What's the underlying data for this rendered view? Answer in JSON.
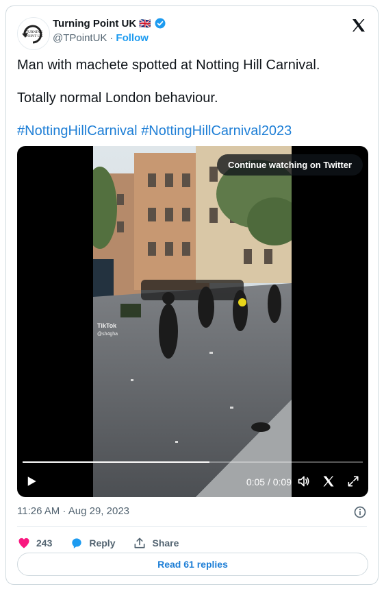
{
  "author": {
    "display_name": "Turning Point UK",
    "flag": "🇬🇧",
    "handle": "@TPointUK",
    "separator": "·",
    "follow_label": "Follow",
    "avatar_text_top": "TURNING",
    "avatar_text_bottom": "POINT UK"
  },
  "tweet": {
    "line1": "Man with machete spotted at Notting Hill Carnival.",
    "line2": "Totally normal London behaviour.",
    "hashtag1": "#NottingHillCarnival",
    "hashtag2": "#NottingHillCarnival2023"
  },
  "video": {
    "continue_label": "Continue watching on Twitter",
    "watermark": "TikTok",
    "watermark_handle": "@sh4gha",
    "time_display": "0:05 / 0:09",
    "progress": 0.55
  },
  "meta": {
    "timestamp": "11:26 AM · Aug 29, 2023"
  },
  "actions": {
    "likes": "243",
    "reply_label": "Reply",
    "share_label": "Share"
  },
  "footer": {
    "read_replies_label": "Read 61 replies"
  },
  "colors": {
    "accent": "#1d9bf0",
    "like": "#f91880",
    "verified": "#1d9bf0"
  },
  "icons": [
    "verified-badge-icon",
    "x-logo-icon",
    "play-icon",
    "volume-icon",
    "x-small-icon",
    "expand-icon",
    "info-icon",
    "heart-icon",
    "reply-bubble-icon",
    "share-icon"
  ]
}
